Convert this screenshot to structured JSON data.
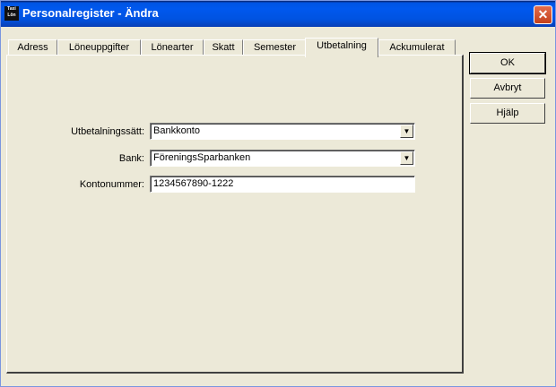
{
  "window": {
    "title": "Personalregister - Ändra",
    "icon_lines": [
      "Taxi",
      "Lön"
    ],
    "close_glyph": "✕"
  },
  "tabs": [
    {
      "label": "Adress",
      "active": false
    },
    {
      "label": "Löneuppgifter",
      "active": false
    },
    {
      "label": "Lönearter",
      "active": false
    },
    {
      "label": "Skatt",
      "active": false
    },
    {
      "label": "Semester",
      "active": false
    },
    {
      "label": "Utbetalning",
      "active": true
    },
    {
      "label": "Ackumulerat",
      "active": false
    }
  ],
  "form": {
    "payment_method": {
      "label": "Utbetalningssätt:",
      "value": "Bankkonto"
    },
    "bank": {
      "label": "Bank:",
      "value": "FöreningsSparbanken"
    },
    "account": {
      "label": "Kontonummer:",
      "value": "1234567890-1222"
    }
  },
  "buttons": {
    "ok": "OK",
    "cancel": "Avbryt",
    "help": "Hjälp"
  },
  "dropdown_arrow": "▼"
}
